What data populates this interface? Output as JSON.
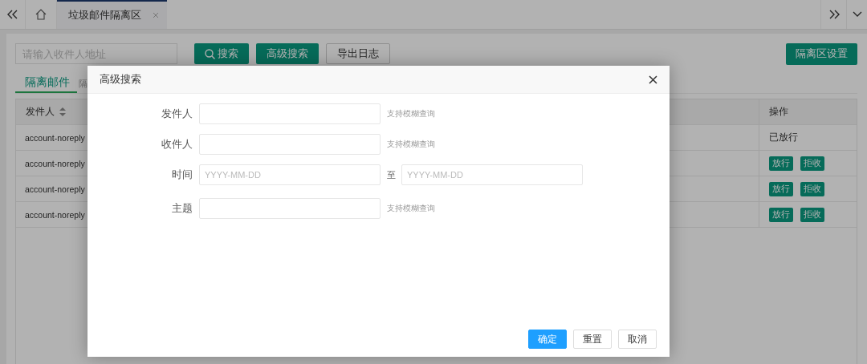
{
  "top_bar": {
    "tabs": [
      {
        "label": "垃圾邮件隔离区",
        "selected": true
      }
    ]
  },
  "toolbar": {
    "search": {
      "placeholder": "请输入收件人地址"
    },
    "buttons": [
      {
        "label": "搜索",
        "kind": "search"
      },
      {
        "label": "高级搜索",
        "kind": "primary"
      },
      {
        "label": "导出日志",
        "kind": "plain"
      }
    ],
    "settings_button": "隔离区设置"
  },
  "view_tabs": [
    {
      "label": "隔离邮件",
      "selected": true
    },
    {
      "label": "隔",
      "selected": false
    }
  ],
  "table": {
    "columns": [
      {
        "label": "发件人",
        "sortable": true
      },
      {
        "label": "操作"
      }
    ],
    "rows": [
      {
        "sender": "account-noreply",
        "kind": "status",
        "status": "已放行"
      },
      {
        "sender": "account-noreply",
        "kind": "actions",
        "actions": [
          "放行",
          "拒收"
        ]
      },
      {
        "sender": "account-noreply",
        "kind": "actions",
        "actions": [
          "放行",
          "拒收"
        ]
      },
      {
        "sender": "account-noreply",
        "kind": "actions",
        "actions": [
          "放行",
          "拒收"
        ]
      }
    ]
  },
  "dialog": {
    "title": "高级搜索",
    "fields": [
      {
        "label": "发件人",
        "kind": "text",
        "hint": "支持模糊查询"
      },
      {
        "label": "收件人",
        "kind": "text",
        "hint": "支持模糊查询"
      },
      {
        "label": "时间",
        "kind": "range",
        "placeholder": "YYYY-MM-DD",
        "separator": "至",
        "placeholder_end": "YYYY-MM-DD"
      },
      {
        "label": "主题",
        "kind": "text",
        "hint": "支持模糊查询"
      }
    ],
    "buttons": [
      {
        "label": "确定",
        "kind": "primary"
      },
      {
        "label": "重置",
        "kind": "plain"
      },
      {
        "label": "取消",
        "kind": "plain"
      }
    ]
  }
}
